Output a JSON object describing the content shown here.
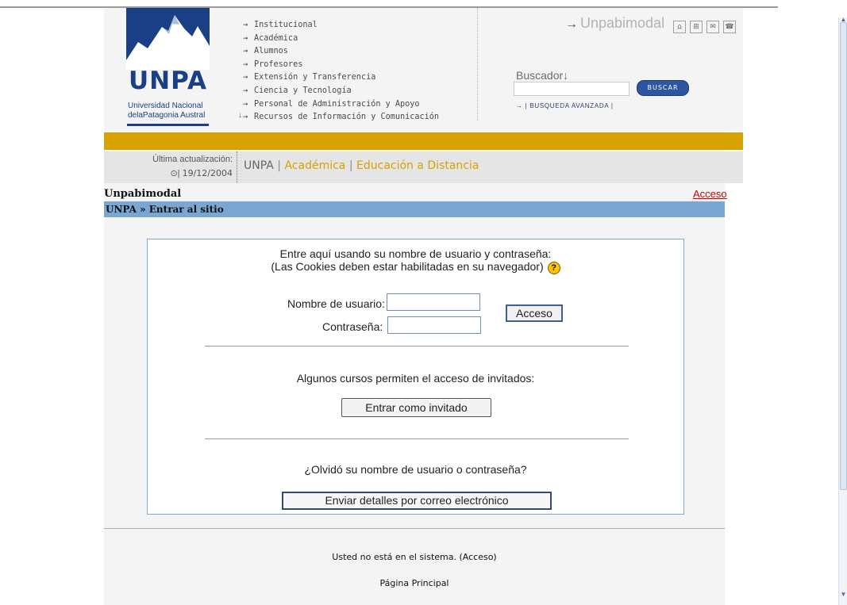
{
  "header": {
    "logo": {
      "word": "UNPA",
      "line1": "Universidad Nacional",
      "line2": "delaPatagonia Austral"
    },
    "nav": [
      {
        "label": "Institucional"
      },
      {
        "label": "Académica"
      },
      {
        "label": "Alumnos"
      },
      {
        "label": "Profesores"
      },
      {
        "label": "Extensión y Transferencia"
      },
      {
        "label": "Ciencia y Tecnología"
      },
      {
        "label": "Personal de Administración y Apoyo"
      },
      {
        "label": "Recursos de Información y Comunicación"
      }
    ],
    "brand": "Unpabimodal",
    "quick_icons": [
      "home-icon",
      "sitemap-icon",
      "mail-icon",
      "phone-icon"
    ],
    "search": {
      "label": "Buscador",
      "button": "BUSCAR",
      "advanced": "| BUSQUEDA AVANZADA |"
    }
  },
  "update": {
    "label": "Última actualización:",
    "date": "19/12/2004"
  },
  "breadcrumb": {
    "root": "UNPA",
    "academic": "Académica",
    "distance": "Educación a Distancia"
  },
  "course": {
    "title": "Unpabimodal",
    "access_link": "Acceso",
    "path_root": "UNPA",
    "path_current": "Entrar al sitio"
  },
  "login": {
    "intro_line1": "Entre aquí usando su nombre de usuario y contraseña:",
    "intro_line2": "(Las Cookies deben estar habilitadas en su navegador)",
    "username_label": "Nombre de usuario:",
    "password_label": "Contraseña:",
    "login_button": "Acceso",
    "guest_text": "Algunos cursos permiten el acceso de invitados:",
    "guest_button": "Entrar como invitado",
    "forgot_text": "¿Olvidó su nombre de usuario o contraseña?",
    "send_button": "Enviar detalles por correo electrónico"
  },
  "footer": {
    "status": "Usted no está en el sistema. (Acceso)",
    "home": "Página Principal"
  },
  "colors": {
    "gold": "#d7a100",
    "blue_bar": "#7aa7d2",
    "brand_blue": "#1b3f84",
    "access_red": "#cc0000"
  }
}
